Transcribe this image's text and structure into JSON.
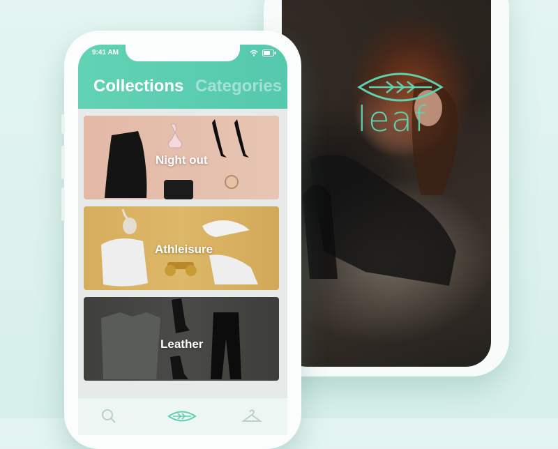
{
  "status_bar": {
    "time": "9:41 AM"
  },
  "header": {
    "tabs": [
      {
        "label": "Collections",
        "active": true
      },
      {
        "label": "Categories",
        "active": false
      }
    ]
  },
  "collections": [
    {
      "label": "Night out",
      "color": "#e3b9a6"
    },
    {
      "label": "Athleisure",
      "color": "#d6ad5c"
    },
    {
      "label": "Leather",
      "color": "#444441"
    }
  ],
  "tab_bar": {
    "icons": [
      "search-icon",
      "leaf-icon",
      "hanger-icon"
    ],
    "active": "leaf-icon"
  },
  "splash": {
    "brand": "leaf"
  },
  "colors": {
    "accent": "#5fd0b0",
    "header": "#62d2b4",
    "background": "#e4f5f1"
  }
}
